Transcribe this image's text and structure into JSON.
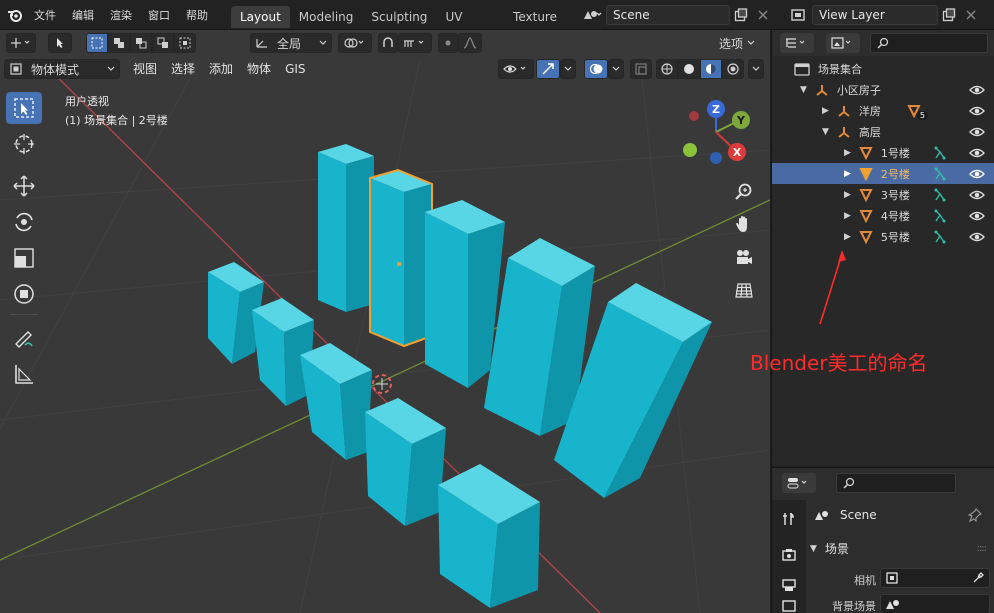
{
  "menubar": {
    "items": [
      "文件",
      "编辑",
      "渲染",
      "窗口",
      "帮助"
    ],
    "workspace_tabs": [
      "Layout",
      "Modeling",
      "Sculpting",
      "UV Editing",
      "Texture Pa"
    ],
    "scene_name": "Scene",
    "view_layer_name": "View Layer"
  },
  "viewport": {
    "transform_orientation": "全局",
    "options_label": "选项",
    "mode_label": "物体模式",
    "menus": [
      "视图",
      "选择",
      "添加",
      "物体",
      "GIS"
    ],
    "overlay_title": "用户透视",
    "overlay_subtitle": "(1) 场景集合 | 2号楼",
    "gizmo": {
      "x": "X",
      "y": "Y",
      "z": "Z"
    }
  },
  "outliner": {
    "root_label": "场景集合",
    "items": [
      {
        "label": "小区房子"
      },
      {
        "label": "洋房",
        "badge": "5"
      },
      {
        "label": "高层"
      },
      {
        "label": "1号楼"
      },
      {
        "label": "2号楼",
        "selected": true
      },
      {
        "label": "3号楼"
      },
      {
        "label": "4号楼"
      },
      {
        "label": "5号楼"
      }
    ]
  },
  "annotation": {
    "text": "Blender美工的命名",
    "color": "#ff2a2a"
  },
  "properties": {
    "scene_name": "Scene",
    "section_label": "场景",
    "camera_label": "相机",
    "background_label": "背景场景"
  },
  "colors": {
    "accent_blue": "#4772b3",
    "object_cyan": "#1ab5cf",
    "selection_orange": "#f0a030",
    "x_axis": "#d13a3a",
    "y_axis": "#7ea83b",
    "annotation_red": "#ff2a2a"
  }
}
